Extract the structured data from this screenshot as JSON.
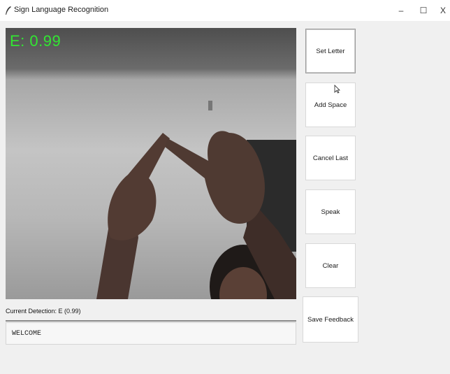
{
  "window": {
    "title": "Sign Language Recognition",
    "minimize_glyph": "–",
    "maximize_glyph": "☐",
    "close_glyph": "X"
  },
  "video": {
    "overlay_text": "E: 0.99",
    "overlay_color": "#32e632"
  },
  "buttons": {
    "set_letter": "Set Letter",
    "add_space": "Add Space",
    "cancel_last": "Cancel Last",
    "speak": "Speak",
    "clear": "Clear",
    "save_feedback": "Save Feedback"
  },
  "detection": {
    "label": "Current Detection:  E (0.99)"
  },
  "output": {
    "text": "WELCOME"
  },
  "icons": {
    "app": "feather-icon",
    "pointer": "mouse-pointer-icon"
  }
}
